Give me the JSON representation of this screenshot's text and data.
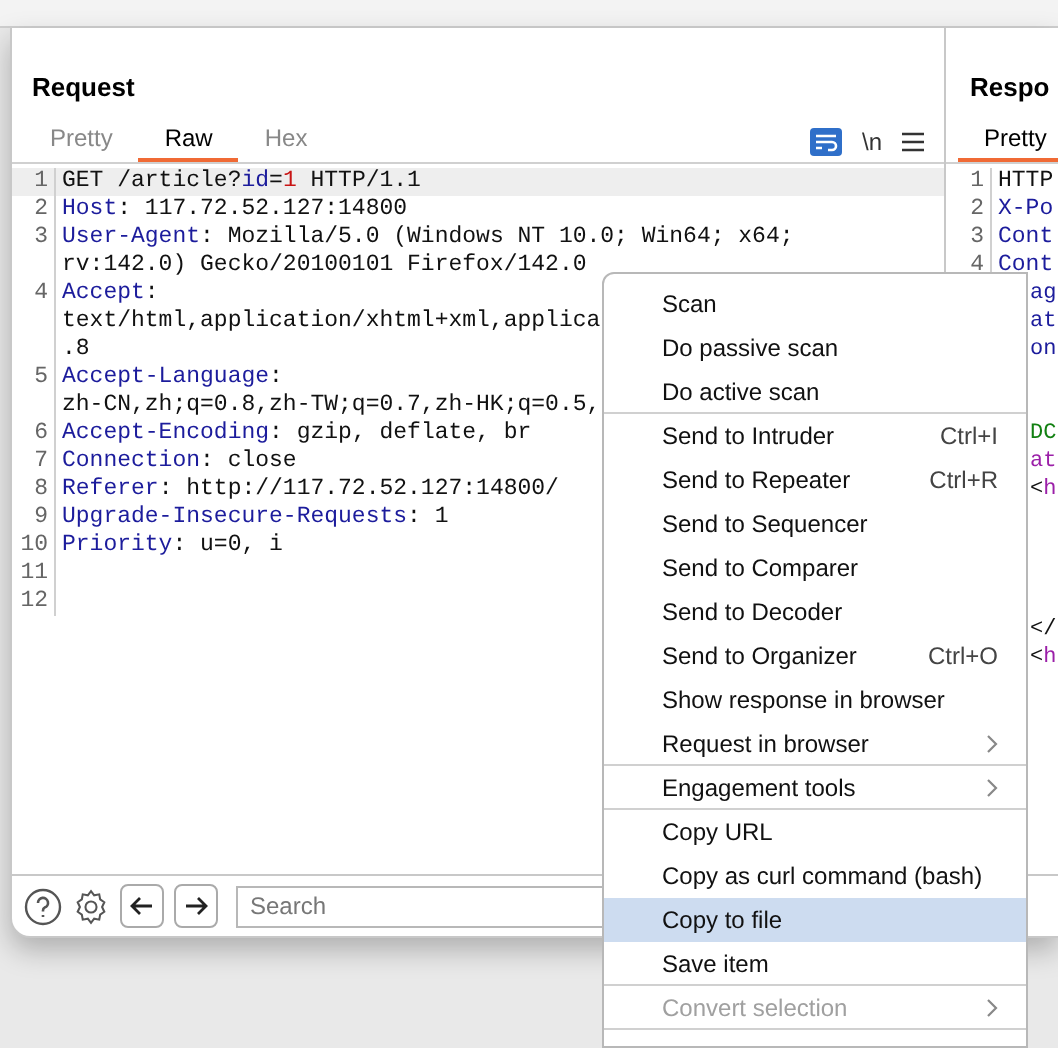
{
  "request": {
    "title": "Request",
    "tabs": [
      {
        "label": "Pretty",
        "selected": false
      },
      {
        "label": "Raw",
        "selected": true
      },
      {
        "label": "Hex",
        "selected": false
      }
    ],
    "newline_toggle": "\\n",
    "lines": [
      {
        "number": "1",
        "highlighted": true,
        "rows": [
          [
            {
              "kind": "plain",
              "text": "GET /article?"
            },
            {
              "kind": "key",
              "text": "id"
            },
            {
              "kind": "plain",
              "text": "="
            },
            {
              "kind": "num",
              "text": "1"
            },
            {
              "kind": "plain",
              "text": " HTTP/1.1"
            }
          ]
        ]
      },
      {
        "number": "2",
        "highlighted": false,
        "rows": [
          [
            {
              "kind": "key",
              "text": "Host"
            },
            {
              "kind": "plain",
              "text": ": 117.72.52.127:14800"
            }
          ]
        ]
      },
      {
        "number": "3",
        "highlighted": false,
        "rows": [
          [
            {
              "kind": "key",
              "text": "User-Agent"
            },
            {
              "kind": "plain",
              "text": ": Mozilla/5.0 (Windows NT 10.0; Win64; x64;"
            }
          ],
          [
            {
              "kind": "plain",
              "text": "rv:142.0) Gecko/20100101 Firefox/142.0"
            }
          ]
        ]
      },
      {
        "number": "4",
        "highlighted": false,
        "rows": [
          [
            {
              "kind": "key",
              "text": "Accept"
            },
            {
              "kind": "plain",
              "text": ":"
            }
          ],
          [
            {
              "kind": "plain",
              "text": "text/html,application/xhtml+xml,applica"
            }
          ],
          [
            {
              "kind": "plain",
              "text": ".8"
            }
          ]
        ]
      },
      {
        "number": "5",
        "highlighted": false,
        "rows": [
          [
            {
              "kind": "key",
              "text": "Accept-Language"
            },
            {
              "kind": "plain",
              "text": ":"
            }
          ],
          [
            {
              "kind": "plain",
              "text": "zh-CN,zh;q=0.8,zh-TW;q=0.7,zh-HK;q=0.5,"
            }
          ]
        ]
      },
      {
        "number": "6",
        "highlighted": false,
        "rows": [
          [
            {
              "kind": "key",
              "text": "Accept-Encoding"
            },
            {
              "kind": "plain",
              "text": ": gzip, deflate, br"
            }
          ]
        ]
      },
      {
        "number": "7",
        "highlighted": false,
        "rows": [
          [
            {
              "kind": "key",
              "text": "Connection"
            },
            {
              "kind": "plain",
              "text": ": close"
            }
          ]
        ]
      },
      {
        "number": "8",
        "highlighted": false,
        "rows": [
          [
            {
              "kind": "key",
              "text": "Referer"
            },
            {
              "kind": "plain",
              "text": ": http://117.72.52.127:14800/"
            }
          ]
        ]
      },
      {
        "number": "9",
        "highlighted": false,
        "rows": [
          [
            {
              "kind": "key",
              "text": "Upgrade-Insecure-Requests"
            },
            {
              "kind": "plain",
              "text": ": 1"
            }
          ]
        ]
      },
      {
        "number": "10",
        "highlighted": false,
        "rows": [
          [
            {
              "kind": "key",
              "text": "Priority"
            },
            {
              "kind": "plain",
              "text": ": u=0, i"
            }
          ]
        ]
      },
      {
        "number": "11",
        "highlighted": false
      },
      {
        "number": "12",
        "highlighted": false
      }
    ]
  },
  "response": {
    "title": "Respo",
    "tabs": [
      {
        "label": "Pretty",
        "selected": true
      }
    ],
    "lines": [
      {
        "kind": "full",
        "number": "1",
        "segments": [
          {
            "kind": "plain",
            "text": "HTTP"
          }
        ]
      },
      {
        "kind": "full",
        "number": "2",
        "segments": [
          {
            "kind": "key",
            "text": "X-Po"
          }
        ]
      },
      {
        "kind": "full",
        "number": "3",
        "segments": [
          {
            "kind": "key",
            "text": "Cont"
          }
        ]
      },
      {
        "kind": "full",
        "number": "4",
        "segments": [
          {
            "kind": "key",
            "text": "Cont"
          }
        ]
      },
      {
        "kind": "partial",
        "segments": [
          {
            "kind": "key",
            "text": "ag"
          }
        ]
      },
      {
        "kind": "partial",
        "segments": [
          {
            "kind": "key",
            "text": "at"
          }
        ]
      },
      {
        "kind": "partial",
        "segments": [
          {
            "kind": "key",
            "text": "on"
          }
        ]
      },
      {
        "kind": "blank"
      },
      {
        "kind": "blank"
      },
      {
        "kind": "partial",
        "segments": [
          {
            "kind": "comment",
            "text": "DC"
          }
        ]
      },
      {
        "kind": "partial",
        "segments": [
          {
            "kind": "tag",
            "text": "at"
          }
        ]
      },
      {
        "kind": "partial",
        "segments": [
          {
            "kind": "plain",
            "text": "<"
          },
          {
            "kind": "tag",
            "text": "h"
          }
        ]
      },
      {
        "kind": "blank"
      },
      {
        "kind": "blank"
      },
      {
        "kind": "blank"
      },
      {
        "kind": "blank"
      },
      {
        "kind": "partial",
        "segments": [
          {
            "kind": "plain",
            "text": "</"
          }
        ]
      },
      {
        "kind": "partial",
        "segments": [
          {
            "kind": "plain",
            "text": "<"
          },
          {
            "kind": "tag",
            "text": "h"
          }
        ]
      }
    ]
  },
  "toolbar": {
    "search": {
      "placeholder": "Search"
    }
  },
  "context_menu": {
    "items": [
      {
        "label": "Scan",
        "selected": false,
        "disabled": false,
        "submenu": false,
        "separator_after": false
      },
      {
        "label": "Do passive scan",
        "selected": false,
        "disabled": false,
        "submenu": false,
        "separator_after": false
      },
      {
        "label": "Do active scan",
        "selected": false,
        "disabled": false,
        "submenu": false,
        "separator_after": true
      },
      {
        "label": "Send to Intruder",
        "shortcut": "Ctrl+I",
        "selected": false,
        "disabled": false,
        "submenu": false,
        "separator_after": false
      },
      {
        "label": "Send to Repeater",
        "shortcut": "Ctrl+R",
        "selected": false,
        "disabled": false,
        "submenu": false,
        "separator_after": false
      },
      {
        "label": "Send to Sequencer",
        "selected": false,
        "disabled": false,
        "submenu": false,
        "separator_after": false
      },
      {
        "label": "Send to Comparer",
        "selected": false,
        "disabled": false,
        "submenu": false,
        "separator_after": false
      },
      {
        "label": "Send to Decoder",
        "selected": false,
        "disabled": false,
        "submenu": false,
        "separator_after": false
      },
      {
        "label": "Send to Organizer",
        "shortcut": "Ctrl+O",
        "selected": false,
        "disabled": false,
        "submenu": false,
        "separator_after": false
      },
      {
        "label": "Show response in browser",
        "selected": false,
        "disabled": false,
        "submenu": false,
        "separator_after": false
      },
      {
        "label": "Request in browser",
        "selected": false,
        "disabled": false,
        "submenu": true,
        "separator_after": true
      },
      {
        "label": "Engagement tools",
        "selected": false,
        "disabled": false,
        "submenu": true,
        "separator_after": true
      },
      {
        "label": "Copy URL",
        "selected": false,
        "disabled": false,
        "submenu": false,
        "separator_after": false
      },
      {
        "label": "Copy as curl command (bash)",
        "selected": false,
        "disabled": false,
        "submenu": false,
        "separator_after": false
      },
      {
        "label": "Copy to file",
        "selected": true,
        "disabled": false,
        "submenu": false,
        "separator_after": false
      },
      {
        "label": "Save item",
        "selected": false,
        "disabled": false,
        "submenu": false,
        "separator_after": true
      },
      {
        "label": "Convert selection",
        "selected": false,
        "disabled": true,
        "submenu": true,
        "separator_after": true
      }
    ]
  }
}
